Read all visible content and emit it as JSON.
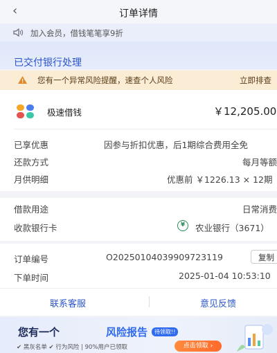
{
  "header": {
    "back_glyph": "‹",
    "title": "订单详情"
  },
  "notice": {
    "icon": "speaker-icon",
    "text": "加入会员，借钱笔笔享9折"
  },
  "status": {
    "text": "已交付银行处理"
  },
  "alert": {
    "icon": "warning-icon",
    "text": "您有一个异常风险提醒，速查个人风险",
    "button": "立即排查"
  },
  "product": {
    "name": "极速借钱",
    "amount": "￥12,205.00"
  },
  "details": {
    "discount_label": "已享优惠",
    "discount_value": "因参与折扣优惠，后1期综合费用全免",
    "repay_label": "还款方式",
    "repay_value": "每月等额",
    "monthly_label": "月供明细",
    "monthly_value": "优惠前 ￥1226.13 × 12期"
  },
  "loan": {
    "purpose_label": "借款用途",
    "purpose_value": "日常消费",
    "bank_label": "收款银行卡",
    "bank_icon_glyph": "¥",
    "bank_value": "农业银行（3671）"
  },
  "order": {
    "number_label": "订单编号",
    "number_value": "O20250104039909723119",
    "copy": "复制",
    "time_label": "下单时间",
    "time_value": "2025-01-04 10:53:10"
  },
  "actions": {
    "contact": "联系客服",
    "feedback": "意见反馈"
  },
  "banner": {
    "title_part1": "您有一个",
    "title_part2": "风险报告",
    "badge": "待领取!!",
    "tags": "✔ 黑灰名单  ✔ 行为风险  |  90%用户已领取",
    "button": "点击领取 ›"
  },
  "colors": {
    "accent": "#2a55c8",
    "alert_bg": "#fbecd6",
    "bank_green": "#2e8b57"
  }
}
